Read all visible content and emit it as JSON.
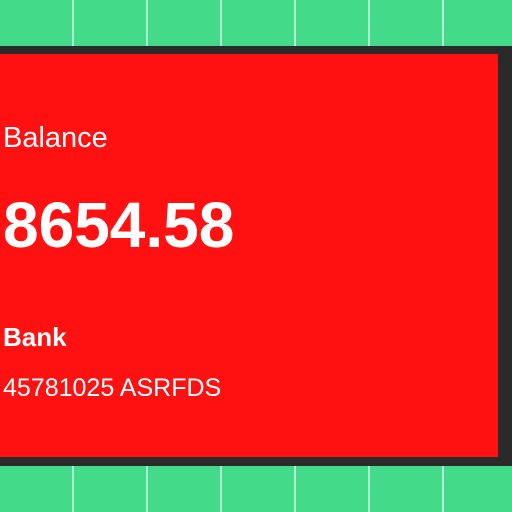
{
  "card": {
    "balance_label": "Balance",
    "balance_amount": "8654.58",
    "bank_label": "Bank",
    "account_info": "45781025 ASRFDS"
  },
  "colors": {
    "card_background": "#FF1011",
    "card_border": "#2A2A2A",
    "page_background": "#43DA8A",
    "text": "#FFFFFF"
  }
}
